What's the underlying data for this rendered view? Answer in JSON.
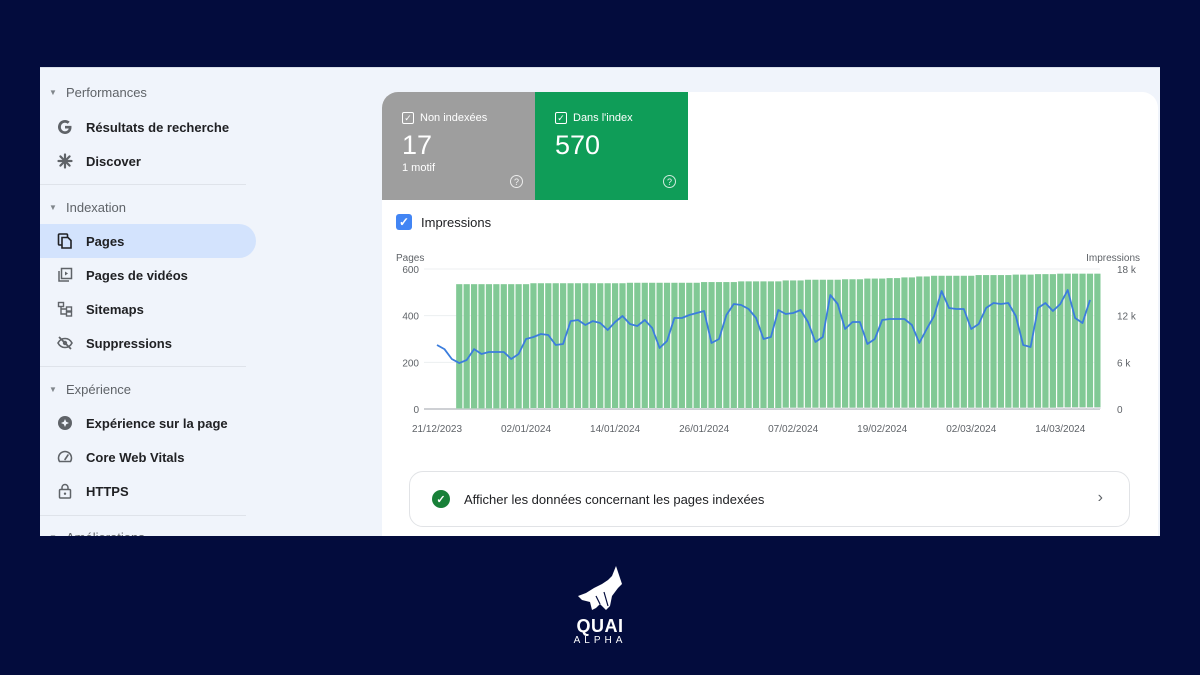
{
  "sidebar": {
    "sections": [
      {
        "label": "Performances",
        "items": [
          {
            "label": "Résultats de recherche",
            "icon": "google-g-icon"
          },
          {
            "label": "Discover",
            "icon": "asterisk-icon"
          }
        ]
      },
      {
        "label": "Indexation",
        "items": [
          {
            "label": "Pages",
            "icon": "pages-icon",
            "active": true
          },
          {
            "label": "Pages de vidéos",
            "icon": "video-pages-icon"
          },
          {
            "label": "Sitemaps",
            "icon": "sitemap-icon"
          },
          {
            "label": "Suppressions",
            "icon": "eye-off-icon"
          }
        ]
      },
      {
        "label": "Expérience",
        "items": [
          {
            "label": "Expérience sur la page",
            "icon": "page-experience-icon"
          },
          {
            "label": "Core Web Vitals",
            "icon": "gauge-icon"
          },
          {
            "label": "HTTPS",
            "icon": "lock-icon"
          }
        ]
      },
      {
        "label": "Améliorations",
        "items": []
      }
    ]
  },
  "tiles": {
    "not_indexed": {
      "label": "Non indexées",
      "value": "17",
      "sub": "1 motif",
      "checked": true,
      "color": "#9e9e9e"
    },
    "indexed": {
      "label": "Dans l'index",
      "value": "570",
      "checked": true,
      "color": "#0f9d58"
    }
  },
  "impressions_toggle": {
    "label": "Impressions",
    "checked": true
  },
  "chart_data": {
    "type": "bar",
    "left_axis_label": "Pages",
    "right_axis_label": "Impressions",
    "left_ticks": [
      "0",
      "200",
      "400",
      "600"
    ],
    "right_ticks": [
      "0",
      "6 k",
      "12 k",
      "18 k"
    ],
    "ylim_left": [
      0,
      600
    ],
    "ylim_right": [
      0,
      18000
    ],
    "x_tick_labels": [
      "21/12/2023",
      "02/01/2024",
      "14/01/2024",
      "26/01/2024",
      "07/02/2024",
      "19/02/2024",
      "02/03/2024",
      "14/03/2024"
    ],
    "x_start": "21/12/2023",
    "x_tick_interval_days": 12,
    "grid": true,
    "bars_start_day": 3,
    "series": [
      {
        "name": "Dans l'index",
        "type": "bar",
        "color": "#81c995",
        "axis": "left",
        "values": [
          533,
          533,
          533,
          533,
          533,
          533,
          533,
          533,
          533,
          533,
          535,
          535,
          535,
          535,
          535,
          535,
          535,
          535,
          535,
          535,
          535,
          535,
          535,
          537,
          537,
          537,
          537,
          537,
          537,
          537,
          537,
          537,
          537,
          540,
          540,
          540,
          540,
          540,
          543,
          543,
          543,
          543,
          543,
          543,
          545,
          545,
          545,
          548,
          548,
          548,
          548,
          548,
          550,
          550,
          550,
          553,
          553,
          553,
          555,
          555,
          558,
          558,
          562,
          562,
          565,
          565,
          565,
          565,
          565,
          565,
          568,
          568,
          568,
          568,
          568,
          570,
          570,
          570,
          572,
          572,
          572,
          572,
          572,
          572,
          572,
          572,
          572
        ]
      },
      {
        "name": "Non indexées",
        "type": "bar",
        "color": "#dadce0",
        "axis": "left",
        "values": [
          2,
          2,
          2,
          2,
          2,
          2,
          2,
          2,
          2,
          2,
          4,
          4,
          4,
          4,
          4,
          4,
          4,
          4,
          4,
          4,
          4,
          4,
          4,
          4,
          4,
          4,
          4,
          4,
          4,
          4,
          4,
          4,
          4,
          4,
          4,
          4,
          4,
          4,
          4,
          4,
          4,
          4,
          4,
          4,
          6,
          6,
          6,
          6,
          6,
          6,
          6,
          6,
          6,
          6,
          6,
          6,
          6,
          6,
          6,
          6,
          6,
          6,
          6,
          6,
          6,
          6,
          6,
          6,
          6,
          6,
          6,
          6,
          6,
          6,
          6,
          6,
          6,
          6,
          6,
          6,
          6,
          8,
          8,
          8,
          8,
          8,
          8
        ]
      },
      {
        "name": "Impressions",
        "type": "line",
        "color": "#3b7ddd",
        "axis": "right",
        "values": [
          8230,
          7700,
          6430,
          5900,
          6300,
          7700,
          7070,
          7330,
          7330,
          7330,
          6430,
          7070,
          9000,
          9260,
          9640,
          9510,
          8230,
          8360,
          11300,
          11440,
          10800,
          11300,
          11060,
          10160,
          11190,
          11960,
          10930,
          10670,
          11440,
          10410,
          7840,
          8740,
          11700,
          11700,
          12090,
          12340,
          12600,
          8490,
          9000,
          12090,
          13500,
          13370,
          12860,
          11700,
          9000,
          9260,
          12730,
          12210,
          12340,
          12730,
          11190,
          8610,
          9260,
          14660,
          13500,
          10290,
          11190,
          11190,
          8360,
          9000,
          11440,
          11570,
          11570,
          11570,
          10800,
          8490,
          10290,
          11960,
          15170,
          12990,
          12860,
          12860,
          10290,
          10930,
          12990,
          13630,
          13500,
          13630,
          11960,
          8230,
          7970,
          12990,
          13630,
          12600,
          13500,
          15300,
          11700,
          11060,
          14020
        ]
      }
    ]
  },
  "indexed_link": {
    "label": "Afficher les données concernant les pages indexées"
  },
  "brand": {
    "name": "QUAI",
    "tagline": "ALPHA"
  }
}
